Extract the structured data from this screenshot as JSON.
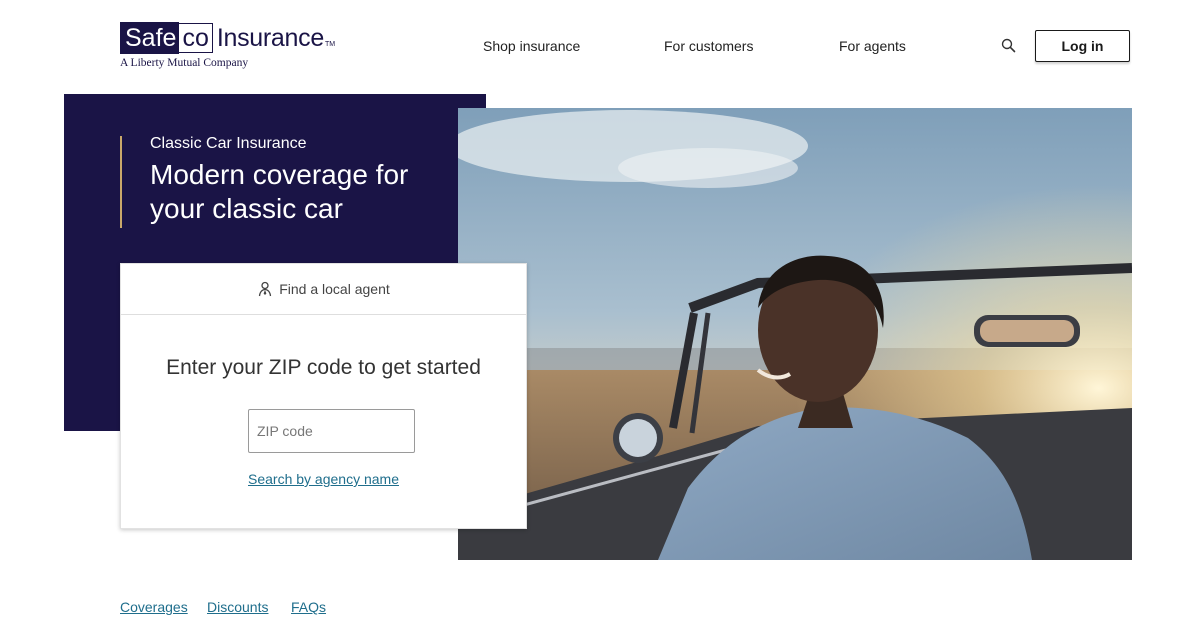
{
  "brand": {
    "logo_part_safe": "Safe",
    "logo_part_co": "co",
    "logo_part_insurance": "Insurance",
    "logo_tm": "TM",
    "tagline": "A Liberty Mutual Company",
    "primary_color": "#1a1446",
    "accent_color": "#c9a86a",
    "link_color": "#1f6e8c"
  },
  "nav": {
    "shop": "Shop insurance",
    "customers": "For customers",
    "agents": "For agents",
    "search_icon": "search-icon",
    "login": "Log in"
  },
  "hero": {
    "kicker": "Classic Car Insurance",
    "title": "Modern coverage for your classic car"
  },
  "agent_card": {
    "header_icon": "agent-person-icon",
    "header_label": "Find a local agent",
    "heading": "Enter your ZIP code to get started",
    "zip_placeholder": "ZIP code",
    "zip_value": "",
    "agency_link": "Search by agency name"
  },
  "subnav": {
    "coverages": "Coverages",
    "discounts": "Discounts",
    "faqs": "FAQs"
  }
}
